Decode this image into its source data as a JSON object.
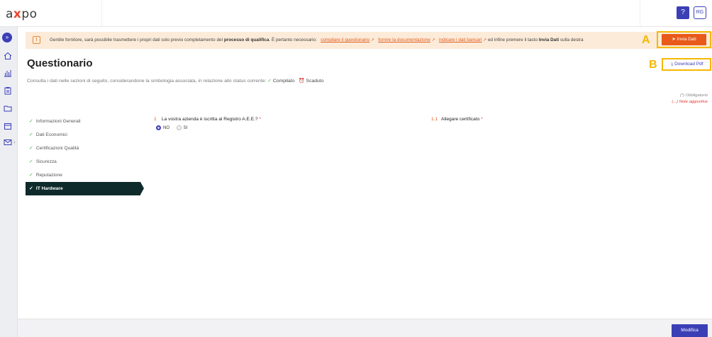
{
  "header": {
    "logo_prefix": "a",
    "logo_x": "x",
    "logo_suffix": "po",
    "help_label": "?",
    "user_initials": "RG"
  },
  "banner": {
    "text_start": "Gentile fornitore, sarà possibile trasmettere i propri dati solo previo completamento del ",
    "text_bold": "processo di qualifica",
    "text_mid": ". È pertanto necessario:",
    "link1": "compilare il questionario",
    "link2": "fornire la documentazione",
    "link3": "indicare i dati bancari",
    "text_end_1": "ed infine premere il tasto ",
    "text_end_bold": "Invia Dati",
    "text_end_2": " sulla destra",
    "external_glyph": "↗",
    "submit_label": "Invia Dati"
  },
  "annotations": {
    "a": "A",
    "b": "B"
  },
  "page": {
    "title": "Questionario",
    "subtitle": "Consulta i dati nelle sezioni di seguito, considerandone la simbologia associata, in relazione allo status corrente:",
    "status_done": "Compilato",
    "status_expired": "Scaduto",
    "download_label": "Download Pdf",
    "legend_required": "(*) Obbligatorio",
    "legend_notes": "(...) Note aggiuntive"
  },
  "sections": [
    {
      "label": "Informazioni Generali"
    },
    {
      "label": "Dati Economici"
    },
    {
      "label": "Certificazioni Qualità"
    },
    {
      "label": "Sicurezza"
    },
    {
      "label": "Reputazione"
    },
    {
      "label": "IT Hardware"
    }
  ],
  "questions": {
    "q1": {
      "number": "1",
      "text": "La vostra azienda è iscritta al Registro A.E.E.? ",
      "star": "*",
      "option_no": "NO",
      "option_si": "SI"
    },
    "q2": {
      "number": "1.1",
      "text": "Allegare certificato ",
      "star": "*"
    }
  },
  "footer": {
    "edit_label": "Modifica"
  },
  "colors": {
    "accent": "#3b3fb6",
    "cta": "#e8591a",
    "banner_bg": "#fbebd8",
    "highlight": "#f5b800",
    "active_section": "#0f2a2b"
  }
}
